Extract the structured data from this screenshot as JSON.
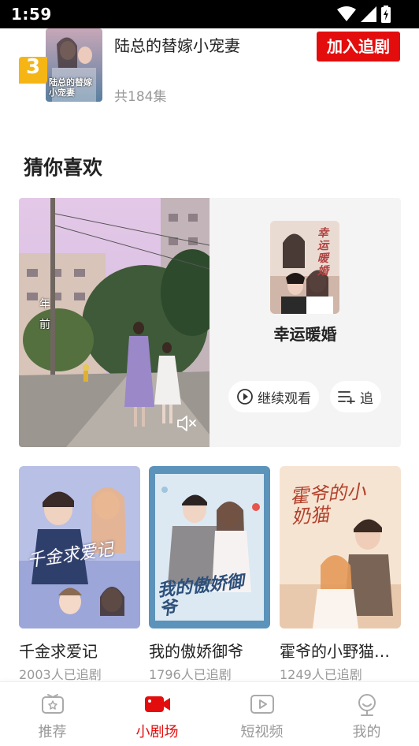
{
  "status_bar": {
    "time": "1:59"
  },
  "top_item": {
    "rank": "3",
    "title": "陆总的替嫁小宠妻",
    "poster_text": "陆总的替嫁小宠妻",
    "episodes": "共184集",
    "button": "加入追剧"
  },
  "section": {
    "title": "猜你喜欢"
  },
  "feature": {
    "video_caption": "年前",
    "cover_text": "幸运暖婚",
    "title": "幸运暖婚",
    "continue_label": "继续观看",
    "follow_label": "追"
  },
  "dramas": [
    {
      "title": "千金求爱记",
      "followers": "2003人已追剧",
      "poster_text": "千金求爱记",
      "color": "#aab4e0"
    },
    {
      "title": "我的傲娇御爷",
      "followers": "1796人已追剧",
      "poster_text": "我的傲娇御爷",
      "color": "#4f89b3"
    },
    {
      "title": "霍爷的小野猫…",
      "followers": "1249人已追剧",
      "poster_text": "霍爷的小奶猫",
      "color": "#f4dcc4"
    }
  ],
  "nav": [
    {
      "label": "推荐",
      "icon": "recommend-icon",
      "active": false
    },
    {
      "label": "小剧场",
      "icon": "theater-camera-icon",
      "active": true
    },
    {
      "label": "短视频",
      "icon": "short-video-icon",
      "active": false
    },
    {
      "label": "我的",
      "icon": "profile-icon",
      "active": false
    }
  ],
  "colors": {
    "accent": "#e40d0d",
    "badge": "#f5b515",
    "muted": "#999999"
  }
}
